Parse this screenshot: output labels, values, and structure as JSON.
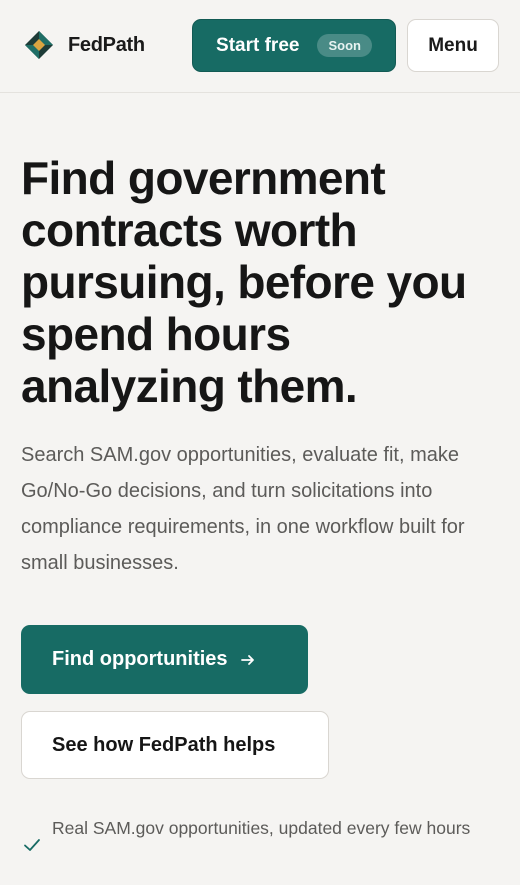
{
  "header": {
    "brand_name": "FedPath",
    "brand_icon": "fedpath-diamond-logo",
    "start_button": {
      "label": "Start free",
      "badge": "Soon"
    },
    "menu_label": "Menu"
  },
  "hero": {
    "headline": "Find government contracts worth pursuing, before you spend hours analyzing them.",
    "subcopy": "Search SAM.gov opportunities, evaluate fit, make Go/No-Go decisions, and turn solicitations into compliance requirements, in one workflow built for small businesses.",
    "primary_cta": {
      "label": "Find opportunities",
      "icon": "arrow-right-icon"
    },
    "secondary_cta": {
      "label": "See how FedPath helps"
    }
  },
  "features": [
    {
      "icon": "checkmark-icon",
      "text": "Real SAM.gov opportunities, updated every few hours"
    }
  ],
  "colors": {
    "accent": "#176b64",
    "background": "#f5f4f2",
    "text": "#161616",
    "muted_text": "#5c5b59",
    "logo_gold": "#d9a441",
    "logo_dark": "#1d3b37"
  }
}
